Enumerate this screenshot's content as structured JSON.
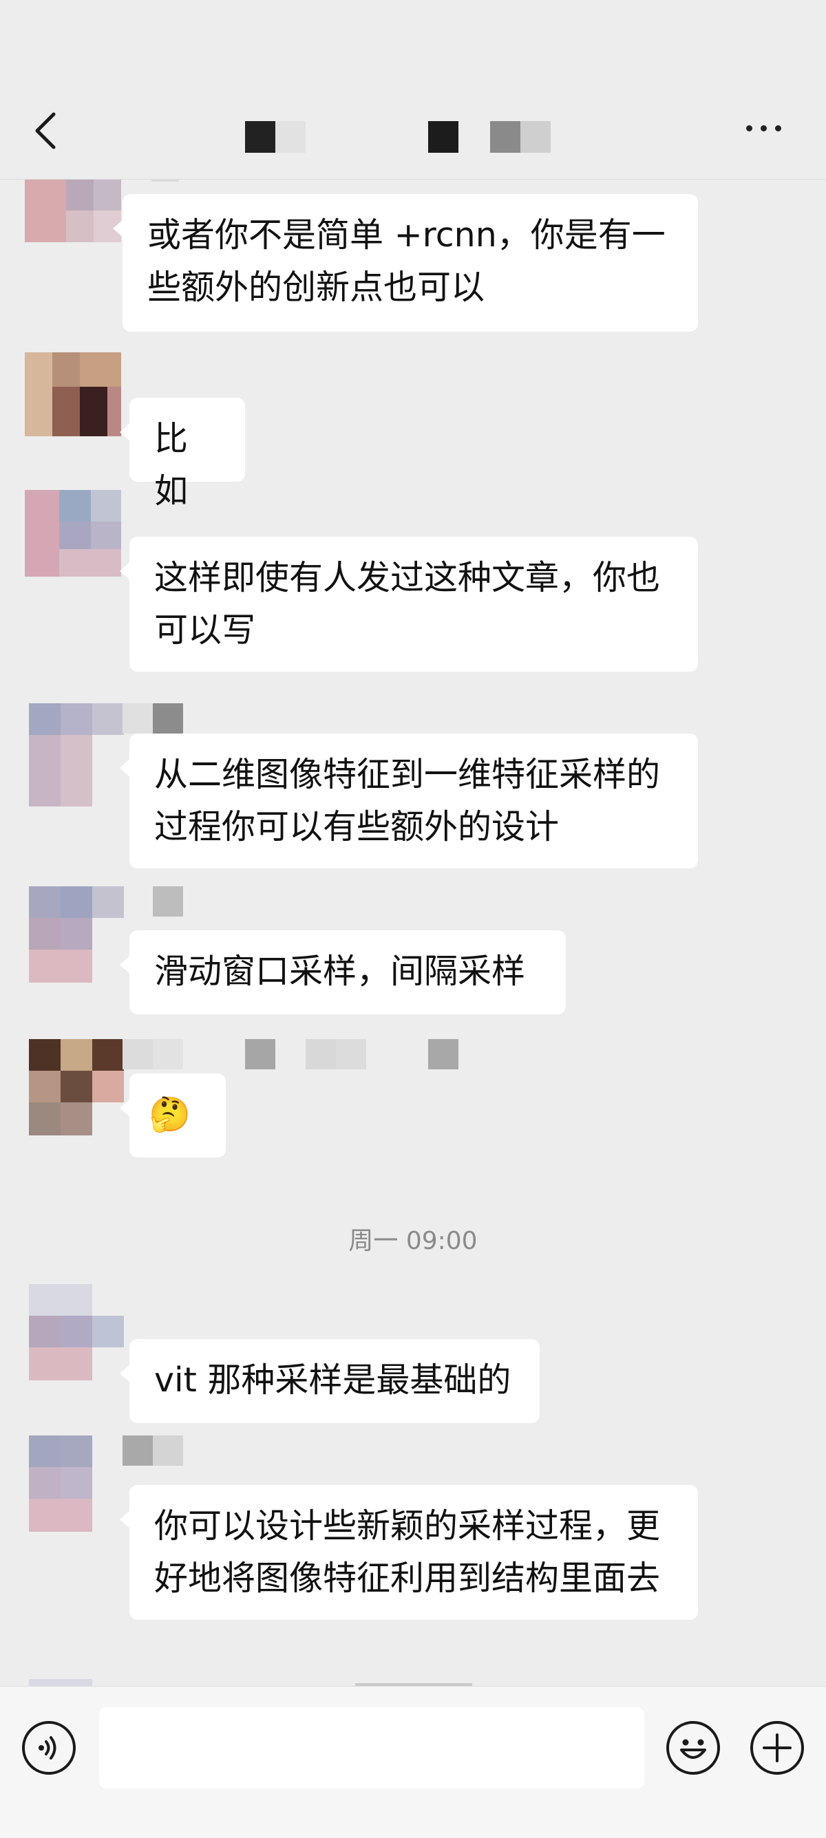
{
  "header": {
    "back_icon": "chevron-left-icon",
    "more_icon": "more-horizontal-icon",
    "title": ""
  },
  "messages": [
    {
      "text": "或者你不是简单 +rcnn，你是有一些额外的创新点也可以"
    },
    {
      "text": "比如"
    },
    {
      "text": "这样即使有人发过这种文章，你也可以写"
    },
    {
      "text": "从二维图像特征到一维特征采样的过程你可以有些额外的设计"
    },
    {
      "text": "滑动窗口采样，间隔采样"
    },
    {
      "text": "🤔"
    },
    {
      "text": "vit 那种采样是最基础的"
    },
    {
      "text": "你可以设计些新颖的采样过程，更好地将图像特征利用到结构里面去"
    }
  ],
  "timestamp": "周一 09:00",
  "bottom_bar": {
    "voice_icon": "voice-icon",
    "emoji_icon": "emoji-icon",
    "plus_icon": "plus-icon",
    "input_value": ""
  },
  "colors": {
    "background": "#ededed",
    "bubble": "#ffffff",
    "timestamp": "#8a8a8a"
  }
}
